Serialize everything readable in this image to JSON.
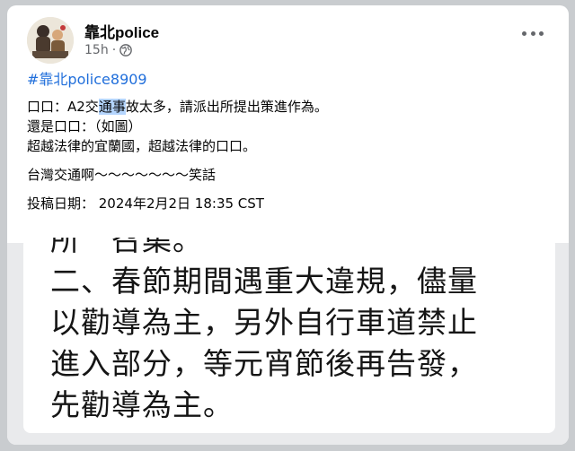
{
  "post": {
    "author": "靠北police",
    "time": "15h",
    "dot": "·",
    "privacy_icon": "globe-icon",
    "more_icon": "more-options-icon"
  },
  "content": {
    "hashtag": "#靠北police8909",
    "line1_prefix": "口口：A2交",
    "line1_highlight": "通事",
    "line1_suffix": "故太多，請派出所提出策進作為。",
    "line2": "還是口口：（如圖）",
    "line3": "超越法律的宜蘭國，超越法律的口口。",
    "line4": "台灣交通啊～～～～～～～笑話",
    "line5": "投稿日期：  2024年2月2日 18:35 CST"
  },
  "image": {
    "clipped_line": "所　召集。",
    "line1": "二、春節期間遇重大違規，儘量",
    "line2": "以勸導為主，另外自行車道禁止",
    "line3": "進入部分，等元宵節後再告發，",
    "line4": "先勸導為主。"
  }
}
